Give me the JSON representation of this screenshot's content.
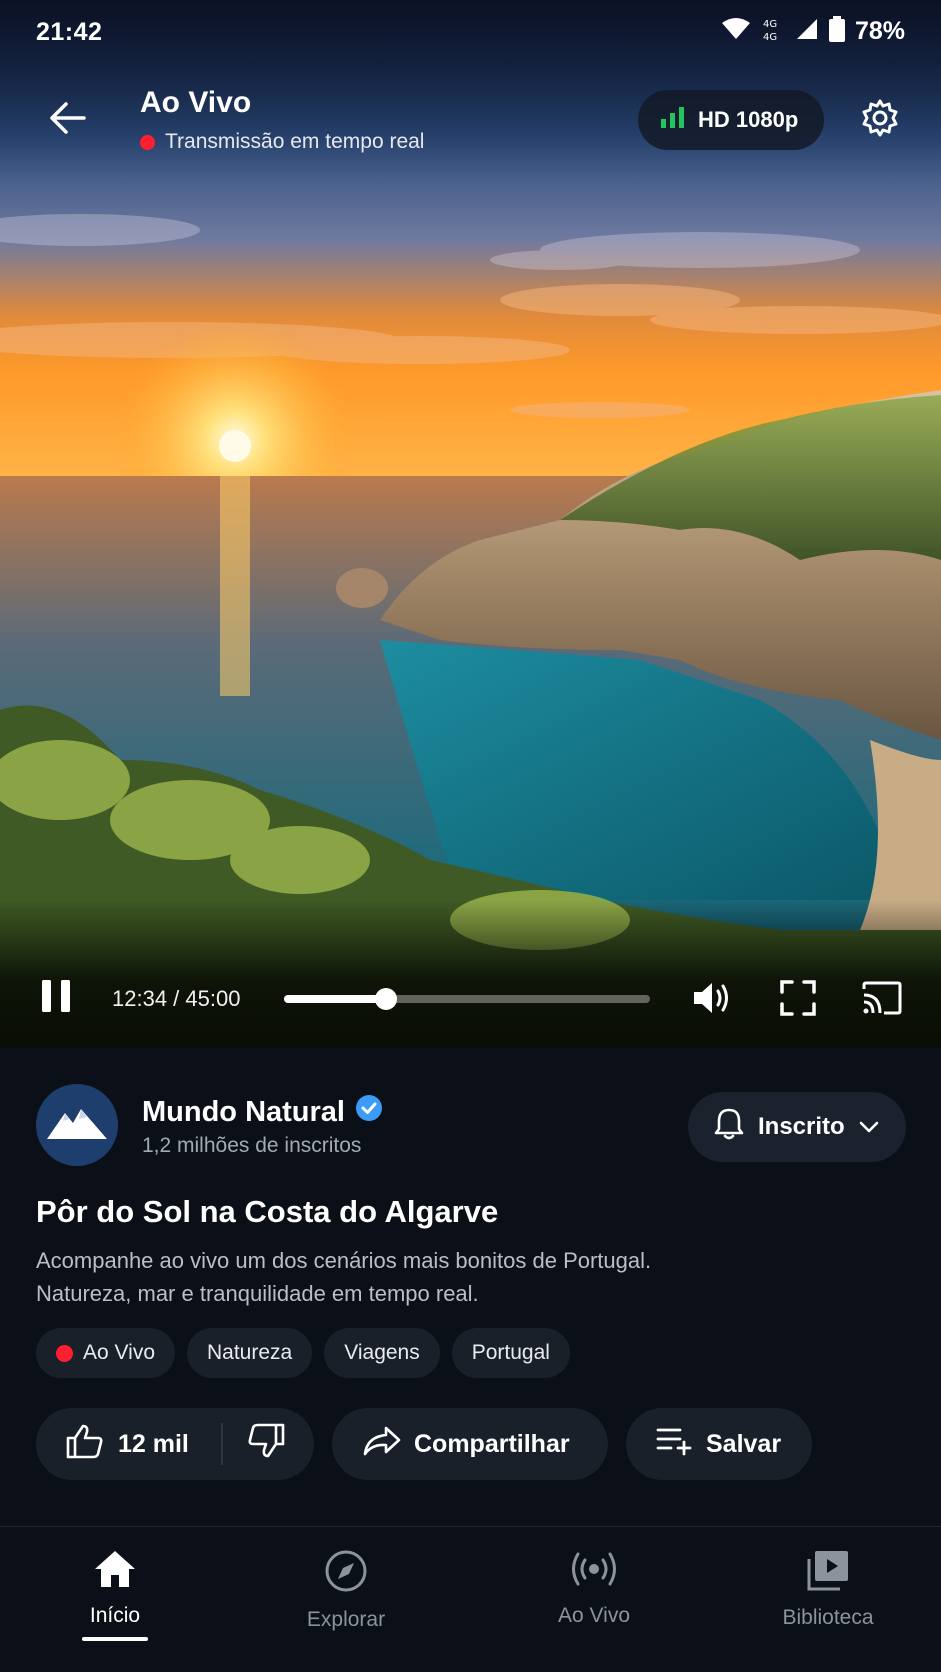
{
  "status_bar": {
    "time": "21:42",
    "network": "4G",
    "battery": "78%"
  },
  "player": {
    "title": "Ao Vivo",
    "subtitle": "Transmissão em tempo real",
    "quality": "HD 1080p",
    "timecode": "12:34 / 45:00",
    "progress": 0.28,
    "live_color": "#ff1f2e",
    "quality_icon_color": "#22c55e"
  },
  "channel": {
    "name": "Mundo Natural",
    "verified": true,
    "subscribers": "1,2 milhões de inscritos",
    "subscribe_label": "Inscrito"
  },
  "video": {
    "title": "Pôr do Sol na Costa do Algarve",
    "description_line1": "Acompanhe ao vivo um dos cenários mais bonitos de Portugal.",
    "description_line2": "Natureza, mar e tranquilidade em tempo real."
  },
  "chips": [
    "Ao Vivo",
    "Natureza",
    "Viagens",
    "Portugal"
  ],
  "actions": {
    "likes": "12 mil",
    "share": "Compartilhar",
    "save": "Salvar"
  },
  "nav": {
    "items": [
      {
        "label": "Início",
        "icon": "home-icon",
        "active": true
      },
      {
        "label": "Explorar",
        "icon": "compass-icon",
        "active": false
      },
      {
        "label": "Ao Vivo",
        "icon": "live-broadcast-icon",
        "active": false
      },
      {
        "label": "Biblioteca",
        "icon": "library-icon",
        "active": false
      }
    ]
  }
}
